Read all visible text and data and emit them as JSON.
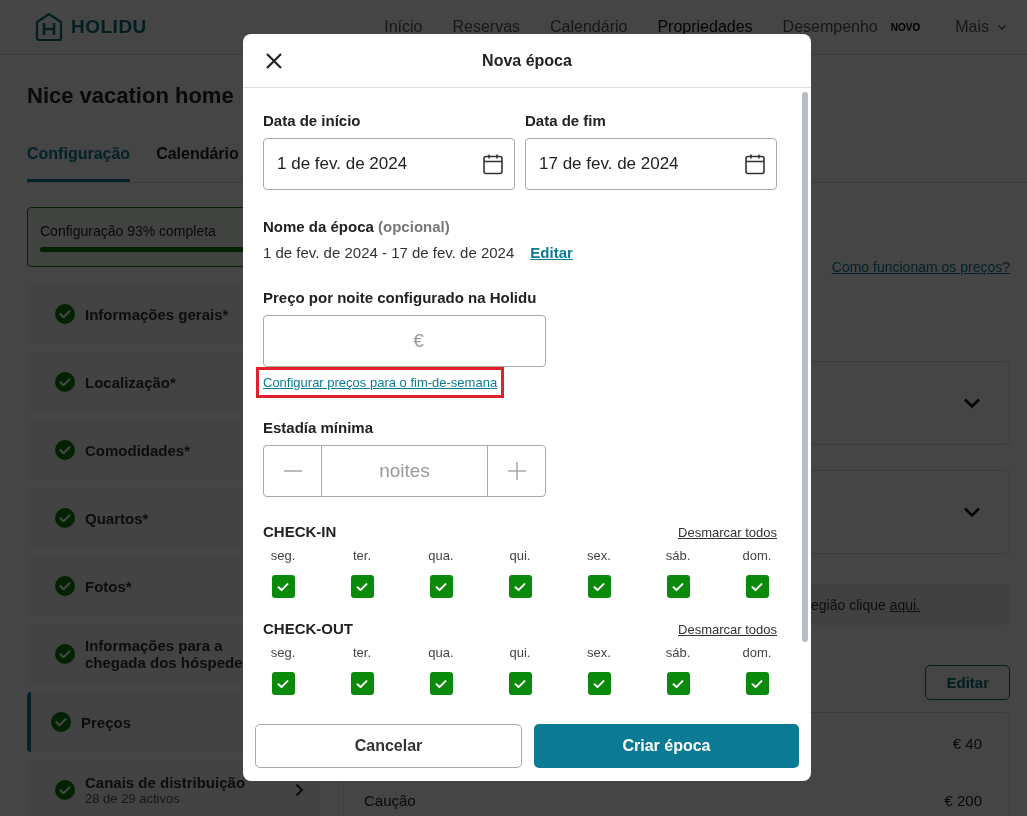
{
  "header": {
    "logo": "HOLIDU",
    "nav": [
      {
        "label": "Início",
        "selected": false
      },
      {
        "label": "Reservas",
        "selected": false
      },
      {
        "label": "Calendário",
        "selected": false
      },
      {
        "label": "Propriedades",
        "selected": true
      },
      {
        "label": "Desempenho",
        "selected": false,
        "badge": "NOVO"
      },
      {
        "label": "Mais",
        "selected": false,
        "dropdown": true
      }
    ]
  },
  "page": {
    "title": "Nice vacation home",
    "tabs": [
      {
        "label": "Configuração",
        "selected": true
      },
      {
        "label": "Calendário",
        "selected": false
      }
    ]
  },
  "sidebar": {
    "progress": {
      "label": "Configuração 93% completa",
      "level": 0.93
    },
    "items": [
      {
        "label": "Informações gerais*",
        "done": true,
        "selected": false
      },
      {
        "label": "Localização*",
        "done": true,
        "selected": false
      },
      {
        "label": "Comodidades*",
        "done": true,
        "selected": false
      },
      {
        "label": "Quartos*",
        "done": true,
        "selected": false
      },
      {
        "label": "Fotos*",
        "done": true,
        "selected": false
      },
      {
        "label": "Informações para a chegada dos hóspede",
        "done": true,
        "selected": false
      },
      {
        "label": "Preços",
        "done": true,
        "selected": true
      },
      {
        "label": "Canais de distribuição",
        "sublabel": "28 de 29 activos",
        "done": true,
        "selected": false,
        "chevron": true
      }
    ]
  },
  "content": {
    "help_link": "Como funcionam os preços?",
    "accordions": [
      {
        "expanded": false
      },
      {
        "expanded": false
      }
    ],
    "notice": {
      "text": "egião clique ",
      "link": "aqui."
    },
    "edit_button": "Editar",
    "rows": [
      {
        "value": "€ 40"
      },
      {
        "label": "Caução",
        "value": "€ 200"
      }
    ]
  },
  "modal": {
    "title": "Nova época",
    "start": {
      "label": "Data de início",
      "value": "1 de fev. de 2024"
    },
    "end": {
      "label": "Data de fim",
      "value": "17 de fev. de 2024"
    },
    "name": {
      "label": "Nome da época",
      "hint": "(opcional)",
      "value": "1 de fev. de 2024 - 17 de fev. de 2024",
      "link": "Editar"
    },
    "price": {
      "label": "Preço por noite configurado na Holidu",
      "placeholder": "€",
      "link": "Configurar preços para o fim-de-semana",
      "highlighted": true
    },
    "min_stay": {
      "label": "Estadía mínima",
      "placeholder": "noites"
    },
    "checkin": {
      "title": "CHECK-IN",
      "clear": "Desmarcar todos",
      "days": [
        {
          "label": "seg.",
          "checked": true
        },
        {
          "label": "ter.",
          "checked": true
        },
        {
          "label": "qua.",
          "checked": true
        },
        {
          "label": "qui.",
          "checked": true
        },
        {
          "label": "sex.",
          "checked": true
        },
        {
          "label": "sáb.",
          "checked": true
        },
        {
          "label": "dom.",
          "checked": true
        }
      ]
    },
    "checkout": {
      "title": "CHECK-OUT",
      "clear": "Desmarcar todos",
      "days": [
        {
          "label": "seg.",
          "checked": true
        },
        {
          "label": "ter.",
          "checked": true
        },
        {
          "label": "qua.",
          "checked": true
        },
        {
          "label": "qui.",
          "checked": true
        },
        {
          "label": "sex.",
          "checked": true
        },
        {
          "label": "sáb.",
          "checked": true
        },
        {
          "label": "dom.",
          "checked": true
        }
      ]
    },
    "cancel": "Cancelar",
    "submit": "Criar época"
  }
}
